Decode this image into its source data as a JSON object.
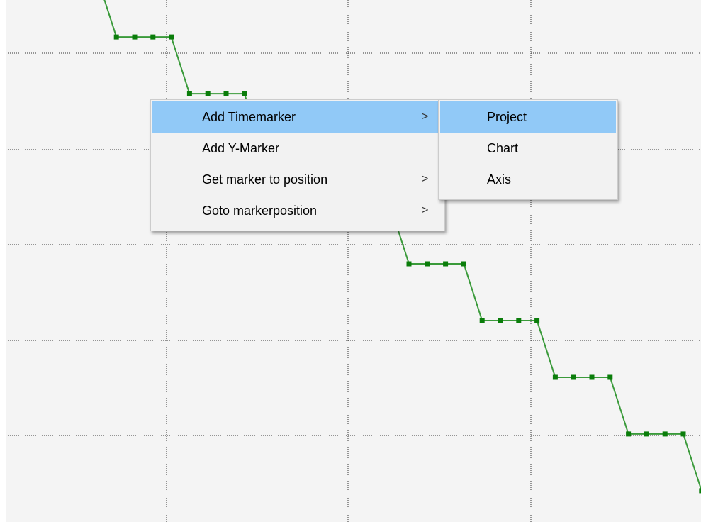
{
  "chart_data": {
    "type": "line",
    "x": [
      0,
      1,
      2,
      3,
      4,
      5,
      6,
      7,
      8,
      9,
      10,
      11,
      12,
      13,
      14,
      15,
      16,
      17,
      18,
      19,
      20,
      21,
      22,
      23,
      24,
      25,
      26,
      27,
      28,
      29,
      30,
      31,
      32,
      33,
      34,
      35,
      36,
      37
    ],
    "series": [
      {
        "values": [
          -1.85,
          -1.85,
          -1.85,
          -1.85,
          -1.25,
          -1.25,
          -1.25,
          -1.25,
          -0.65,
          -0.65,
          -0.65,
          -0.65,
          -0.05,
          -0.05,
          -0.05,
          -0.05,
          0.55,
          0.55,
          0.55,
          0.55,
          1.15,
          1.15,
          1.15,
          1.15,
          1.75,
          1.75,
          1.75,
          1.75,
          2.35,
          2.35,
          2.35,
          2.35,
          2.95,
          2.95,
          2.95,
          2.95,
          3.55,
          3.55
        ],
        "color": "#0a7d0a"
      }
    ],
    "grid": true,
    "line_color": "#3a9a3a",
    "marker_color": "#0a7d0a",
    "background": "#f4f4f4",
    "grid_color": "#333333"
  },
  "context_menu": {
    "items": [
      {
        "label": "Add Timemarker",
        "has_submenu": true,
        "highlighted": true
      },
      {
        "label": "Add Y-Marker",
        "has_submenu": false,
        "highlighted": false
      },
      {
        "label": "Get marker to position",
        "has_submenu": true,
        "highlighted": false
      },
      {
        "label": "Goto markerposition",
        "has_submenu": true,
        "highlighted": false
      }
    ],
    "arrow_glyph": ">"
  },
  "submenu": {
    "items": [
      {
        "label": "Project",
        "highlighted": true
      },
      {
        "label": "Chart",
        "highlighted": false
      },
      {
        "label": "Axis",
        "highlighted": false
      }
    ]
  },
  "colors": {
    "highlight": "#91c9f7",
    "menu_background": "#f2f2f2"
  }
}
